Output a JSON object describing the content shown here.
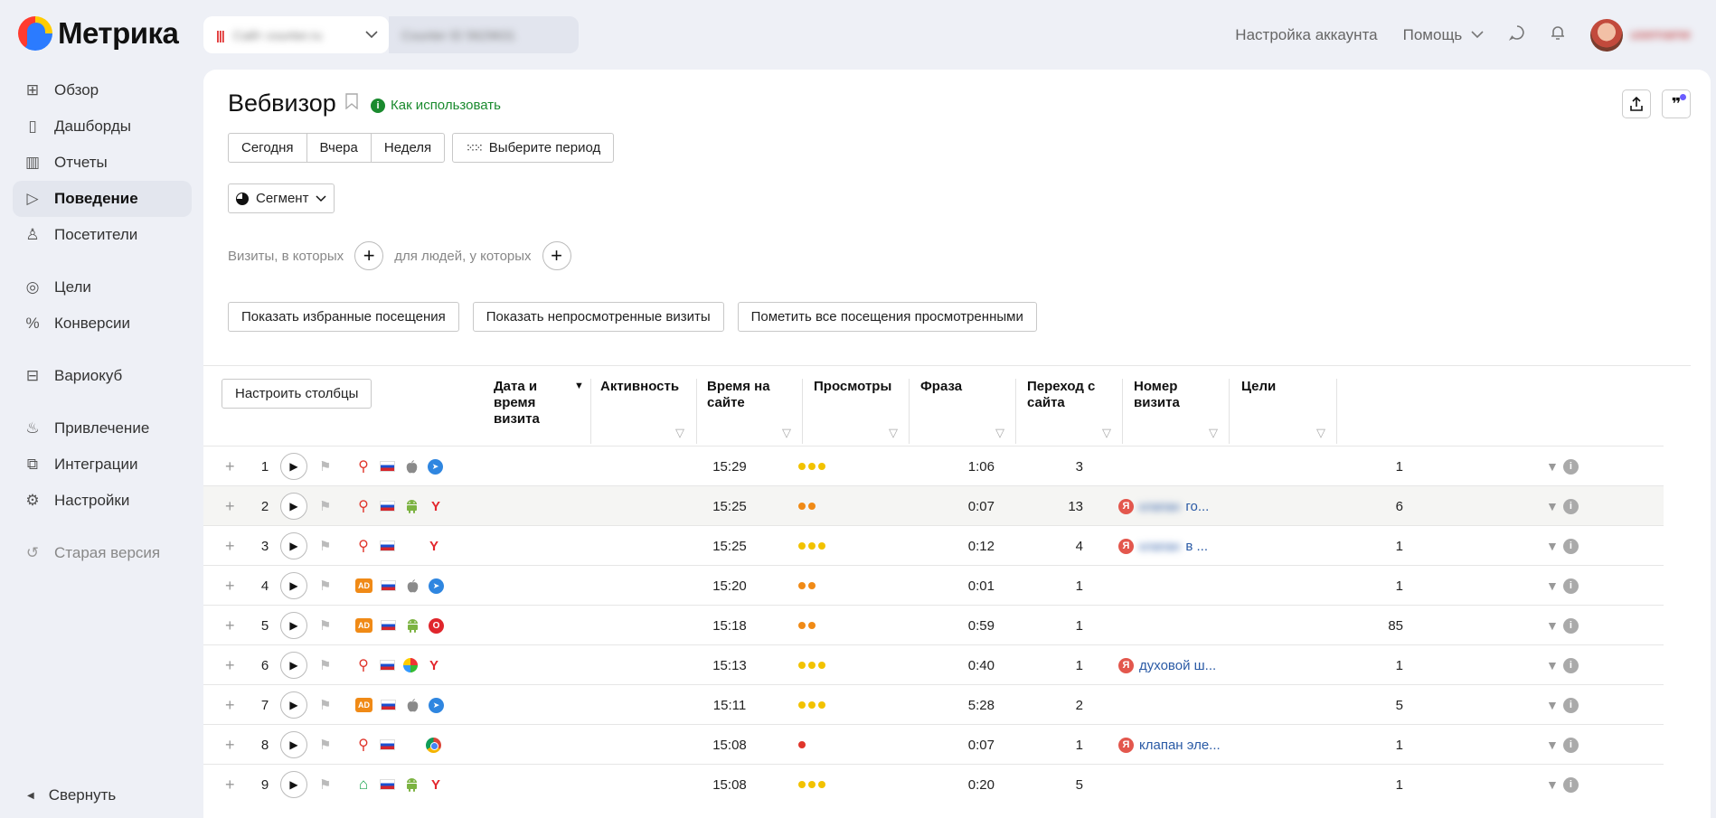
{
  "app": {
    "logo_text": "Метрика"
  },
  "counter": {
    "blurred_name": "Сайт counter.ru",
    "blurred_extra": "Counter ID 5629631"
  },
  "topnav": {
    "account_settings": "Настройка аккаунта",
    "help": "Помощь",
    "user_blur": "username"
  },
  "sidebar": {
    "items": [
      {
        "label": "Обзор",
        "icon": "grid-icon"
      },
      {
        "label": "Дашборды",
        "icon": "dashboard-icon"
      },
      {
        "label": "Отчеты",
        "icon": "bar-chart-icon"
      },
      {
        "label": "Поведение",
        "icon": "play-icon",
        "active": true
      },
      {
        "label": "Посетители",
        "icon": "user-icon"
      },
      {
        "label": "Цели",
        "icon": "target-icon"
      },
      {
        "label": "Конверсии",
        "icon": "percent-icon"
      },
      {
        "label": "Вариокуб",
        "icon": "cube-icon"
      },
      {
        "label": "Привлечение",
        "icon": "fire-icon"
      },
      {
        "label": "Интеграции",
        "icon": "puzzle-icon"
      },
      {
        "label": "Настройки",
        "icon": "gear-icon"
      },
      {
        "label": "Старая версия",
        "icon": "undo-icon"
      }
    ],
    "collapse": "Свернуть"
  },
  "page": {
    "title": "Вебвизор",
    "howto": "Как использовать",
    "periods": [
      "Сегодня",
      "Вчера",
      "Неделя"
    ],
    "period_picker": "Выберите период",
    "segment": "Сегмент",
    "filter_visits": "Визиты, в которых",
    "filter_people": "для людей, у которых",
    "show_favorites": "Показать избранные посещения",
    "show_unviewed": "Показать непросмотренные визиты",
    "mark_all_viewed": "Пометить все посещения просмотренными",
    "configure_columns": "Настроить столбцы"
  },
  "table": {
    "headers": {
      "datetime": "Дата и время визита",
      "activity": "Активность",
      "duration": "Время на сайте",
      "views": "Просмотры",
      "phrase": "Фраза",
      "referrer": "Переход с сайта",
      "visit_number": "Номер визита",
      "goals": "Цели"
    },
    "rows": [
      {
        "n": "1",
        "source": "search",
        "os": "apple",
        "browser": "safari",
        "time": "15:29",
        "activity": 3,
        "duration": "1:06",
        "views": "3",
        "phrase": "",
        "visit_number": "1"
      },
      {
        "n": "2",
        "source": "search",
        "os": "android",
        "browser": "yandex",
        "time": "15:25",
        "activity": 2,
        "duration": "0:07",
        "views": "13",
        "phrase": "го...",
        "phrase_blur": "клапан",
        "visit_number": "6",
        "highlight": true
      },
      {
        "n": "3",
        "source": "search",
        "os": "windows",
        "browser": "yandex",
        "time": "15:25",
        "activity": 3,
        "duration": "0:12",
        "views": "4",
        "phrase": "в ...",
        "phrase_blur": "клапан",
        "visit_number": "1"
      },
      {
        "n": "4",
        "source": "ad",
        "os": "apple",
        "browser": "safari",
        "time": "15:20",
        "activity": 2,
        "duration": "0:01",
        "views": "1",
        "phrase": "",
        "visit_number": "1"
      },
      {
        "n": "5",
        "source": "ad",
        "os": "android",
        "browser": "opera",
        "time": "15:18",
        "activity": 2,
        "duration": "0:59",
        "views": "1",
        "phrase": "",
        "visit_number": "85"
      },
      {
        "n": "6",
        "source": "search",
        "os": "winxp",
        "browser": "yandex",
        "time": "15:13",
        "activity": 3,
        "duration": "0:40",
        "views": "1",
        "phrase": "духовой ш...",
        "visit_number": "1"
      },
      {
        "n": "7",
        "source": "ad",
        "os": "apple",
        "browser": "safari",
        "time": "15:11",
        "activity": 3,
        "duration": "5:28",
        "views": "2",
        "phrase": "",
        "visit_number": "5"
      },
      {
        "n": "8",
        "source": "search",
        "os": "windows",
        "browser": "chrome",
        "time": "15:08",
        "activity": 1,
        "duration": "0:07",
        "views": "1",
        "phrase": "клапан эле...",
        "visit_number": "1"
      },
      {
        "n": "9",
        "source": "direct",
        "os": "android",
        "browser": "yandex",
        "time": "15:08",
        "activity": 3,
        "duration": "0:20",
        "views": "5",
        "phrase": "",
        "visit_number": "1"
      }
    ]
  },
  "colors": {
    "activity_orange": "#f08a16",
    "activity_yellow": "#f2c200",
    "activity_red": "#e0352b",
    "active_nav_bg": "#e3e6ee"
  }
}
